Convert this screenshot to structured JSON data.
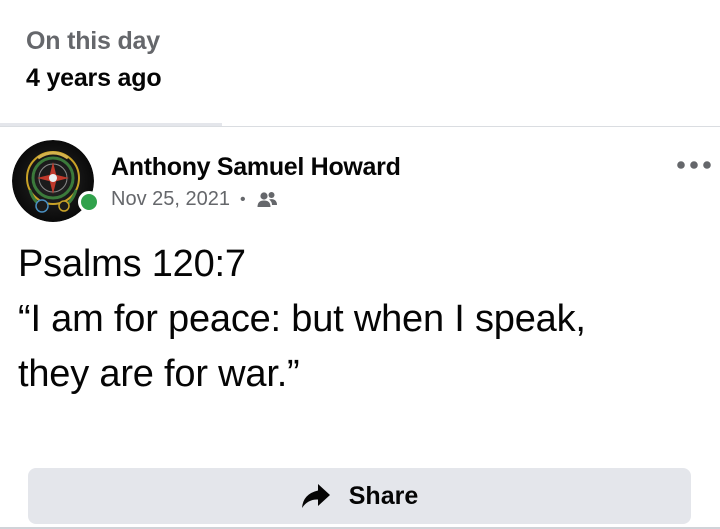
{
  "memory": {
    "title": "On this day",
    "subtitle": "4 years ago"
  },
  "post": {
    "author": "Anthony Samuel Howard",
    "date": "Nov 25, 2021",
    "separator": "•",
    "audience_icon": "friends-icon",
    "avatar_icon": "atlas-logo-avatar",
    "online_status": "online",
    "lines": [
      "Psalms 120:7",
      "“I am for peace: but when I speak,",
      "they are for war.”"
    ]
  },
  "actions": {
    "share_label": "Share",
    "share_icon": "share-arrow-icon",
    "more_icon": "more-options-icon"
  },
  "colors": {
    "primary_text": "#050505",
    "secondary_text": "#65676b",
    "button_bg": "#e4e6eb",
    "online_green": "#31a24c"
  }
}
